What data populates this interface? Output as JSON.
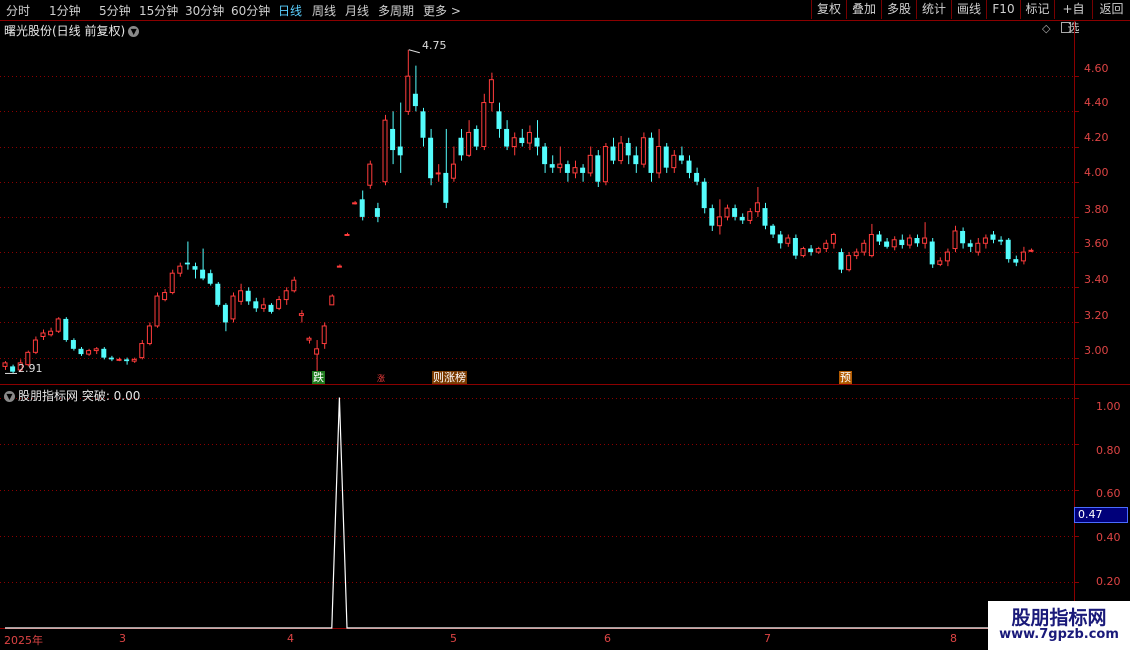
{
  "toolbar": {
    "periods": [
      "分时",
      "1分钟",
      "5分钟",
      "15分钟",
      "30分钟",
      "60分钟",
      "日线",
      "周线",
      "月线",
      "多周期",
      "更多 >"
    ],
    "right": [
      "复权",
      "叠加",
      "多股",
      "统计",
      "画线",
      "F10",
      "标记",
      "+自选",
      "返回"
    ]
  },
  "chart_title": "曙光股份(日线 前复权)",
  "indicator_title": "股朋指标网 突破: 0.00",
  "price_axis": [
    "4.60",
    "4.40",
    "4.20",
    "4.00",
    "3.80",
    "3.60",
    "3.40",
    "3.20",
    "3.00"
  ],
  "indicator_axis": [
    "1.00",
    "0.80",
    "0.60",
    "0.40",
    "0.20"
  ],
  "indicator_highlight": "0.47",
  "high_label": "4.75",
  "low_label": "2.91",
  "date_axis": [
    "2025年",
    "3",
    "4",
    "5",
    "6",
    "7",
    "8"
  ],
  "signals": [
    "跌",
    "涨",
    "则涨榜",
    "预"
  ],
  "watermark": {
    "line1": "股朋指标网",
    "line2": "www.7gpzb.com"
  },
  "colors": {
    "up": "#ff3c3c",
    "down": "#54fcfc",
    "grid": "#8b0000",
    "active": "#5ad0ff"
  },
  "chart_data": [
    {
      "type": "candlestick",
      "title": "曙光股份(日线 前复权)",
      "ylim": [
        2.85,
        4.8
      ],
      "candles": [
        [
          2.95,
          2.97,
          2.93,
          2.98
        ],
        [
          2.95,
          2.92,
          2.91,
          2.96
        ],
        [
          2.93,
          2.97,
          2.92,
          2.99
        ],
        [
          2.96,
          3.03,
          2.95,
          3.04
        ],
        [
          3.03,
          3.1,
          3.02,
          3.12
        ],
        [
          3.12,
          3.14,
          3.1,
          3.16
        ],
        [
          3.13,
          3.15,
          3.12,
          3.17
        ],
        [
          3.15,
          3.22,
          3.14,
          3.23
        ],
        [
          3.22,
          3.1,
          3.09,
          3.23
        ],
        [
          3.1,
          3.05,
          3.04,
          3.11
        ],
        [
          3.05,
          3.02,
          3.01,
          3.06
        ],
        [
          3.02,
          3.04,
          3.01,
          3.05
        ],
        [
          3.04,
          3.05,
          3.02,
          3.06
        ],
        [
          3.05,
          3.0,
          2.99,
          3.06
        ],
        [
          3.0,
          2.99,
          2.98,
          3.01
        ],
        [
          2.99,
          2.99,
          2.98,
          3.0
        ],
        [
          2.99,
          2.98,
          2.96,
          3.0
        ],
        [
          2.98,
          2.99,
          2.97,
          3.0
        ],
        [
          3.0,
          3.08,
          2.99,
          3.1
        ],
        [
          3.08,
          3.18,
          3.07,
          3.2
        ],
        [
          3.18,
          3.35,
          3.17,
          3.37
        ],
        [
          3.33,
          3.37,
          3.32,
          3.39
        ],
        [
          3.37,
          3.48,
          3.36,
          3.5
        ],
        [
          3.48,
          3.52,
          3.46,
          3.54
        ],
        [
          3.54,
          3.53,
          3.5,
          3.66
        ],
        [
          3.52,
          3.5,
          3.45,
          3.54
        ],
        [
          3.5,
          3.45,
          3.44,
          3.62
        ],
        [
          3.48,
          3.42,
          3.41,
          3.5
        ],
        [
          3.42,
          3.3,
          3.29,
          3.43
        ],
        [
          3.3,
          3.2,
          3.15,
          3.31
        ],
        [
          3.22,
          3.35,
          3.2,
          3.37
        ],
        [
          3.32,
          3.38,
          3.3,
          3.42
        ],
        [
          3.38,
          3.32,
          3.3,
          3.4
        ],
        [
          3.32,
          3.28,
          3.26,
          3.34
        ],
        [
          3.28,
          3.3,
          3.26,
          3.34
        ],
        [
          3.3,
          3.26,
          3.25,
          3.31
        ],
        [
          3.28,
          3.33,
          3.27,
          3.35
        ],
        [
          3.33,
          3.38,
          3.3,
          3.4
        ],
        [
          3.38,
          3.44,
          3.37,
          3.46
        ],
        [
          3.24,
          3.25,
          3.2,
          3.27
        ],
        [
          3.1,
          3.11,
          3.08,
          3.12
        ],
        [
          3.02,
          3.05,
          2.91,
          3.1
        ],
        [
          3.08,
          3.18,
          3.05,
          3.2
        ],
        [
          3.3,
          3.35,
          3.32,
          3.36
        ],
        [
          3.52,
          3.52,
          3.52,
          3.53
        ],
        [
          3.7,
          3.7,
          3.7,
          3.71
        ],
        [
          3.88,
          3.88,
          3.87,
          3.89
        ],
        [
          3.9,
          3.8,
          3.78,
          3.95
        ],
        [
          3.98,
          4.1,
          3.96,
          4.12
        ],
        [
          3.85,
          3.8,
          3.77,
          3.88
        ],
        [
          4.0,
          4.35,
          3.98,
          4.38
        ],
        [
          4.3,
          4.18,
          4.1,
          4.4
        ],
        [
          4.2,
          4.15,
          4.05,
          4.45
        ],
        [
          4.4,
          4.6,
          4.38,
          4.75
        ],
        [
          4.5,
          4.43,
          4.4,
          4.66
        ],
        [
          4.4,
          4.25,
          4.2,
          4.42
        ],
        [
          4.25,
          4.02,
          3.98,
          4.3
        ],
        [
          4.05,
          4.05,
          4.0,
          4.1
        ],
        [
          4.05,
          3.88,
          3.85,
          4.3
        ],
        [
          4.02,
          4.1,
          4.0,
          4.2
        ],
        [
          4.25,
          4.15,
          4.12,
          4.3
        ],
        [
          4.15,
          4.28,
          4.14,
          4.35
        ],
        [
          4.3,
          4.2,
          4.18,
          4.32
        ],
        [
          4.2,
          4.45,
          4.18,
          4.5
        ],
        [
          4.45,
          4.58,
          4.4,
          4.62
        ],
        [
          4.4,
          4.3,
          4.25,
          4.45
        ],
        [
          4.3,
          4.2,
          4.18,
          4.35
        ],
        [
          4.2,
          4.25,
          4.15,
          4.28
        ],
        [
          4.25,
          4.22,
          4.2,
          4.3
        ],
        [
          4.22,
          4.28,
          4.18,
          4.32
        ],
        [
          4.25,
          4.2,
          4.15,
          4.35
        ],
        [
          4.2,
          4.1,
          4.05,
          4.22
        ],
        [
          4.1,
          4.08,
          4.05,
          4.15
        ],
        [
          4.08,
          4.1,
          4.05,
          4.2
        ],
        [
          4.1,
          4.05,
          4.0,
          4.12
        ],
        [
          4.05,
          4.08,
          4.02,
          4.12
        ],
        [
          4.08,
          4.05,
          4.0,
          4.1
        ],
        [
          4.05,
          4.15,
          4.03,
          4.2
        ],
        [
          4.15,
          4.0,
          3.97,
          4.18
        ],
        [
          4.0,
          4.2,
          3.98,
          4.22
        ],
        [
          4.2,
          4.12,
          4.1,
          4.25
        ],
        [
          4.12,
          4.22,
          4.1,
          4.26
        ],
        [
          4.22,
          4.15,
          4.1,
          4.25
        ],
        [
          4.15,
          4.1,
          4.05,
          4.2
        ],
        [
          4.1,
          4.25,
          4.08,
          4.28
        ],
        [
          4.25,
          4.05,
          4.0,
          4.28
        ],
        [
          4.05,
          4.2,
          4.02,
          4.3
        ],
        [
          4.2,
          4.08,
          4.05,
          4.22
        ],
        [
          4.08,
          4.15,
          4.05,
          4.18
        ],
        [
          4.15,
          4.12,
          4.1,
          4.2
        ],
        [
          4.12,
          4.05,
          4.02,
          4.15
        ],
        [
          4.05,
          4.0,
          3.98,
          4.08
        ],
        [
          4.0,
          3.85,
          3.82,
          4.02
        ],
        [
          3.85,
          3.75,
          3.72,
          3.87
        ],
        [
          3.75,
          3.8,
          3.7,
          3.9
        ],
        [
          3.8,
          3.85,
          3.78,
          3.87
        ],
        [
          3.85,
          3.8,
          3.78,
          3.87
        ],
        [
          3.8,
          3.78,
          3.76,
          3.82
        ],
        [
          3.78,
          3.83,
          3.76,
          3.85
        ],
        [
          3.83,
          3.88,
          3.8,
          3.97
        ],
        [
          3.85,
          3.75,
          3.73,
          3.88
        ],
        [
          3.75,
          3.7,
          3.68,
          3.76
        ],
        [
          3.7,
          3.65,
          3.62,
          3.72
        ],
        [
          3.65,
          3.68,
          3.63,
          3.7
        ],
        [
          3.68,
          3.58,
          3.56,
          3.7
        ],
        [
          3.58,
          3.62,
          3.57,
          3.63
        ],
        [
          3.62,
          3.6,
          3.58,
          3.64
        ],
        [
          3.6,
          3.62,
          3.59,
          3.63
        ],
        [
          3.62,
          3.65,
          3.6,
          3.67
        ],
        [
          3.65,
          3.7,
          3.62,
          3.71
        ],
        [
          3.6,
          3.5,
          3.48,
          3.62
        ],
        [
          3.5,
          3.58,
          3.49,
          3.6
        ],
        [
          3.58,
          3.6,
          3.56,
          3.62
        ],
        [
          3.6,
          3.65,
          3.58,
          3.67
        ],
        [
          3.58,
          3.7,
          3.57,
          3.76
        ],
        [
          3.7,
          3.66,
          3.64,
          3.72
        ],
        [
          3.66,
          3.63,
          3.62,
          3.68
        ],
        [
          3.63,
          3.67,
          3.61,
          3.69
        ],
        [
          3.67,
          3.64,
          3.62,
          3.7
        ],
        [
          3.64,
          3.68,
          3.62,
          3.7
        ],
        [
          3.68,
          3.65,
          3.63,
          3.7
        ],
        [
          3.65,
          3.68,
          3.62,
          3.77
        ],
        [
          3.66,
          3.53,
          3.51,
          3.68
        ],
        [
          3.53,
          3.55,
          3.52,
          3.57
        ],
        [
          3.55,
          3.6,
          3.52,
          3.62
        ],
        [
          3.62,
          3.72,
          3.6,
          3.75
        ],
        [
          3.72,
          3.65,
          3.62,
          3.74
        ],
        [
          3.65,
          3.63,
          3.6,
          3.67
        ],
        [
          3.6,
          3.65,
          3.58,
          3.68
        ],
        [
          3.65,
          3.68,
          3.62,
          3.7
        ],
        [
          3.7,
          3.67,
          3.65,
          3.72
        ],
        [
          3.67,
          3.66,
          3.64,
          3.69
        ],
        [
          3.67,
          3.56,
          3.54,
          3.68
        ],
        [
          3.56,
          3.54,
          3.52,
          3.58
        ],
        [
          3.55,
          3.6,
          3.53,
          3.63
        ],
        [
          3.61,
          3.61,
          3.6,
          3.62
        ]
      ]
    },
    {
      "type": "line",
      "title": "股朋指标网 突破: 0.00",
      "ylim": [
        0,
        1.05
      ],
      "spike_index": 44,
      "spike_value": 1.0
    }
  ]
}
